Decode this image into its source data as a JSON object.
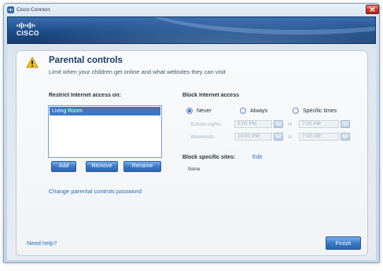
{
  "window": {
    "title": "Cisco Connect",
    "app_icon": "cisco-connect-app-icon",
    "close_icon": "close-icon"
  },
  "banner": {
    "logo_icon": "cisco-bridge-logo",
    "logo_text": "CISCO"
  },
  "page": {
    "icon": "warning-icon",
    "title": "Parental controls",
    "subtitle": "Limit when your children get online and what websites they can visit"
  },
  "restrict": {
    "label": "Restrict Internet access on:",
    "devices": [
      {
        "name": "Living Room",
        "selected": true
      }
    ],
    "buttons": {
      "add": "Add",
      "remove": "Remove",
      "rename": "Rename"
    },
    "password_link": "Change parental controls password"
  },
  "block_access": {
    "label": "Block Internet access",
    "options": [
      {
        "label": "Never",
        "selected": true
      },
      {
        "label": "Always",
        "selected": false
      },
      {
        "label": "Specific times",
        "selected": false
      }
    ],
    "schedule": [
      {
        "label": "School nights",
        "from": "9:00 PM",
        "separator": "to",
        "until": "7:00 AM",
        "disabled": true,
        "dropdown_icon": "chevron-down-icon"
      },
      {
        "label": "Weekends",
        "from": "10:00 PM",
        "separator": "to",
        "until": "7:00 AM",
        "disabled": true,
        "dropdown_icon": "chevron-down-icon"
      }
    ]
  },
  "block_sites": {
    "label": "Block specific sites:",
    "edit_link": "Edit",
    "value": "None"
  },
  "footer": {
    "help_link": "Need help?",
    "finish_button": "Finish"
  },
  "colors": {
    "banner": "#1f4d88",
    "accent": "#3a78c6",
    "link": "#2d6bb8",
    "title": "#1e3d66",
    "selection": "#3b76c7",
    "close": "#c4392d",
    "warning": "#f3c21b"
  }
}
